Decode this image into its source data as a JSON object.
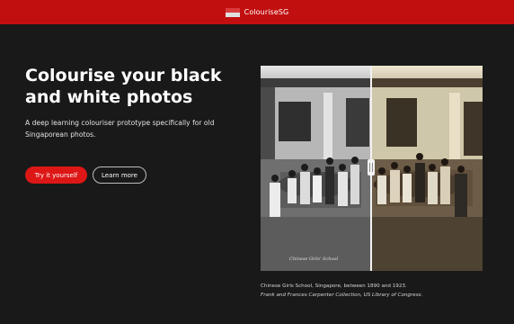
{
  "header": {
    "brand_name": "ColouriseSG",
    "logo_icon": "singapore-flag-icon",
    "background_color": "#c10f0f"
  },
  "hero": {
    "title": "Colourise your black and white photos",
    "subtitle": "A deep learning colouriser prototype specifically for old Singaporean photos.",
    "primary_button_label": "Try it yourself",
    "secondary_button_label": "Learn more",
    "primary_button_color": "#dd1616"
  },
  "comparison_image": {
    "left_half": "black-and-white original",
    "right_half": "colourised",
    "slider_handle_icon": "drag-divider-icon",
    "watermark_text": "Chinese Girls' School"
  },
  "caption": {
    "line1": "Chinese Girls School, Singapore, between 1890 and 1923.",
    "line2": "Frank and Frances Carpenter Collection, US Library of Congress."
  }
}
